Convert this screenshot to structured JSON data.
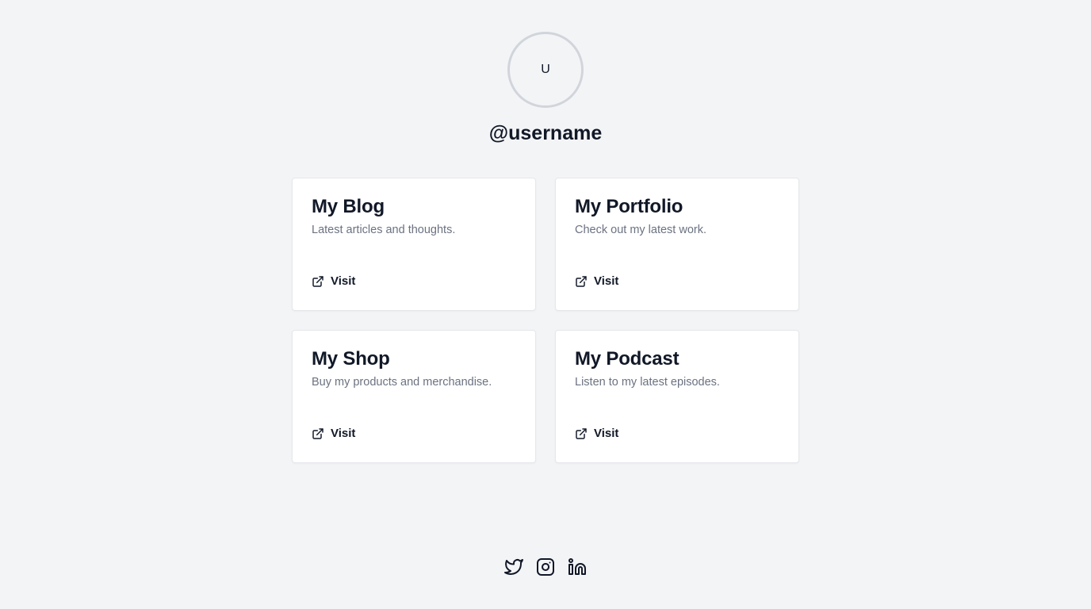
{
  "profile": {
    "avatar_initial": "U",
    "username": "@username"
  },
  "cards": [
    {
      "title": "My Blog",
      "description": "Latest articles and thoughts.",
      "link_label": "Visit",
      "icon": "external-link-icon"
    },
    {
      "title": "My Portfolio",
      "description": "Check out my latest work.",
      "link_label": "Visit",
      "icon": "external-link-icon"
    },
    {
      "title": "My Shop",
      "description": "Buy my products and merchandise.",
      "link_label": "Visit",
      "icon": "external-link-icon"
    },
    {
      "title": "My Podcast",
      "description": "Listen to my latest episodes.",
      "link_label": "Visit",
      "icon": "external-link-icon"
    }
  ],
  "socials": [
    {
      "name": "twitter",
      "icon": "twitter-icon"
    },
    {
      "name": "instagram",
      "icon": "instagram-icon"
    },
    {
      "name": "linkedin",
      "icon": "linkedin-icon"
    }
  ],
  "colors": {
    "background": "#f3f4f6",
    "card_background": "#ffffff",
    "text_primary": "#111827",
    "text_secondary": "#6b7280",
    "avatar_border": "#d1d5db"
  }
}
